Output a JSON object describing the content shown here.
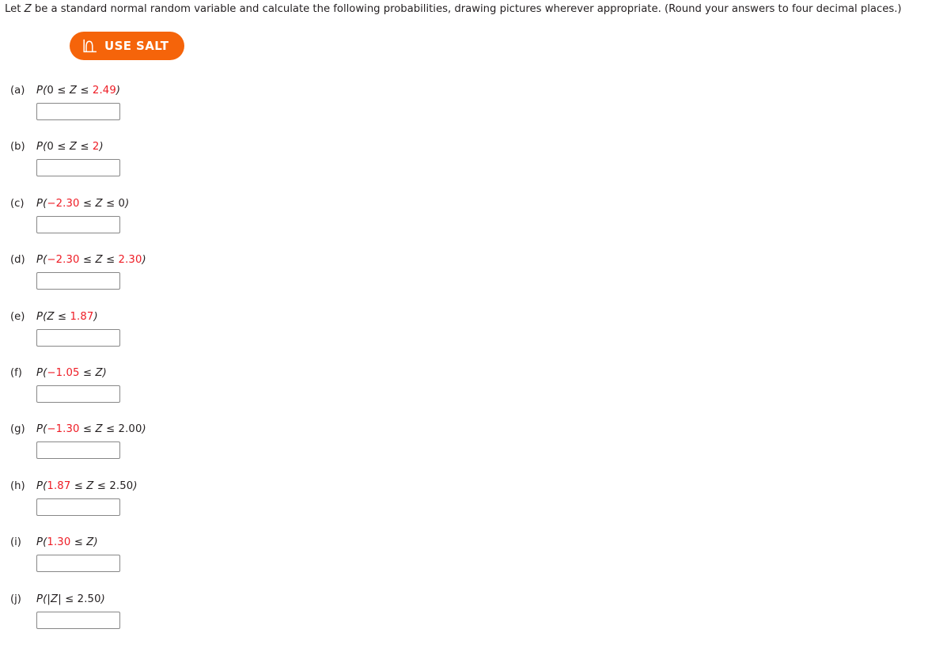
{
  "prompt": {
    "part1": "Let ",
    "variable": "Z",
    "part2": " be a standard normal random variable and calculate the following probabilities, drawing pictures wherever appropriate. (Round your answers to four decimal places.)"
  },
  "salt_button": {
    "label": "USE SALT",
    "icon": "normal-curve-icon",
    "background_color": "#f5640a",
    "text_color": "#ffffff"
  },
  "colors": {
    "highlight_red": "#ee1c25",
    "text": "#231f20",
    "input_border": "#878787"
  },
  "input": {
    "value": "",
    "placeholder": ""
  },
  "questions": [
    {
      "label": "(a)",
      "expression": "P(0 ≤ Z ≤ 2.49)",
      "tokens": [
        {
          "t": "P(",
          "style": "italic"
        },
        {
          "t": "0",
          "style": "num"
        },
        {
          "t": " ≤ ",
          "style": "op"
        },
        {
          "t": "Z",
          "style": "italic"
        },
        {
          "t": " ≤ ",
          "style": "op"
        },
        {
          "t": "2.49",
          "style": "red"
        },
        {
          "t": ")",
          "style": "italic"
        }
      ],
      "answer": ""
    },
    {
      "label": "(b)",
      "expression": "P(0 ≤ Z ≤ 2)",
      "tokens": [
        {
          "t": "P(",
          "style": "italic"
        },
        {
          "t": "0",
          "style": "num"
        },
        {
          "t": " ≤ ",
          "style": "op"
        },
        {
          "t": "Z",
          "style": "italic"
        },
        {
          "t": " ≤ ",
          "style": "op"
        },
        {
          "t": "2",
          "style": "red"
        },
        {
          "t": ")",
          "style": "italic"
        }
      ],
      "answer": ""
    },
    {
      "label": "(c)",
      "expression": "P(−2.30 ≤ Z ≤ 0)",
      "tokens": [
        {
          "t": "P(",
          "style": "italic"
        },
        {
          "t": "−2.30",
          "style": "red"
        },
        {
          "t": " ≤ ",
          "style": "op"
        },
        {
          "t": "Z",
          "style": "italic"
        },
        {
          "t": " ≤ ",
          "style": "op"
        },
        {
          "t": "0",
          "style": "num"
        },
        {
          "t": ")",
          "style": "italic"
        }
      ],
      "answer": ""
    },
    {
      "label": "(d)",
      "expression": "P(−2.30 ≤ Z ≤ 2.30)",
      "tokens": [
        {
          "t": "P(",
          "style": "italic"
        },
        {
          "t": "−2.30",
          "style": "red"
        },
        {
          "t": " ≤ ",
          "style": "op"
        },
        {
          "t": "Z",
          "style": "italic"
        },
        {
          "t": " ≤ ",
          "style": "op"
        },
        {
          "t": "2.30",
          "style": "red"
        },
        {
          "t": ")",
          "style": "italic"
        }
      ],
      "answer": ""
    },
    {
      "label": "(e)",
      "expression": "P(Z ≤ 1.87)",
      "tokens": [
        {
          "t": "P(",
          "style": "italic"
        },
        {
          "t": "Z",
          "style": "italic"
        },
        {
          "t": " ≤ ",
          "style": "op"
        },
        {
          "t": "1.87",
          "style": "red"
        },
        {
          "t": ")",
          "style": "italic"
        }
      ],
      "answer": ""
    },
    {
      "label": "(f)",
      "expression": "P(−1.05 ≤ Z)",
      "tokens": [
        {
          "t": "P(",
          "style": "italic"
        },
        {
          "t": "−1.05",
          "style": "red"
        },
        {
          "t": " ≤ ",
          "style": "op"
        },
        {
          "t": "Z",
          "style": "italic"
        },
        {
          "t": ")",
          "style": "italic"
        }
      ],
      "answer": ""
    },
    {
      "label": "(g)",
      "expression": "P(−1.30 ≤ Z ≤ 2.00)",
      "tokens": [
        {
          "t": "P(",
          "style": "italic"
        },
        {
          "t": "−1.30",
          "style": "red"
        },
        {
          "t": " ≤ ",
          "style": "op"
        },
        {
          "t": "Z",
          "style": "italic"
        },
        {
          "t": " ≤ ",
          "style": "op"
        },
        {
          "t": "2.00",
          "style": "num"
        },
        {
          "t": ")",
          "style": "italic"
        }
      ],
      "answer": ""
    },
    {
      "label": "(h)",
      "expression": "P(1.87 ≤ Z ≤ 2.50)",
      "tokens": [
        {
          "t": "P(",
          "style": "italic"
        },
        {
          "t": "1.87",
          "style": "red"
        },
        {
          "t": " ≤ ",
          "style": "op"
        },
        {
          "t": "Z",
          "style": "italic"
        },
        {
          "t": " ≤ ",
          "style": "op"
        },
        {
          "t": "2.50",
          "style": "num"
        },
        {
          "t": ")",
          "style": "italic"
        }
      ],
      "answer": ""
    },
    {
      "label": "(i)",
      "expression": "P(1.30 ≤ Z)",
      "tokens": [
        {
          "t": "P(",
          "style": "italic"
        },
        {
          "t": "1.30",
          "style": "red"
        },
        {
          "t": " ≤ ",
          "style": "op"
        },
        {
          "t": "Z",
          "style": "italic"
        },
        {
          "t": ")",
          "style": "italic"
        }
      ],
      "answer": ""
    },
    {
      "label": "(j)",
      "expression": "P(|Z| ≤ 2.50)",
      "tokens": [
        {
          "t": "P(|",
          "style": "italic"
        },
        {
          "t": "Z",
          "style": "italic"
        },
        {
          "t": "| ≤ ",
          "style": "op"
        },
        {
          "t": "2.50",
          "style": "num"
        },
        {
          "t": ")",
          "style": "italic"
        }
      ],
      "answer": ""
    }
  ]
}
